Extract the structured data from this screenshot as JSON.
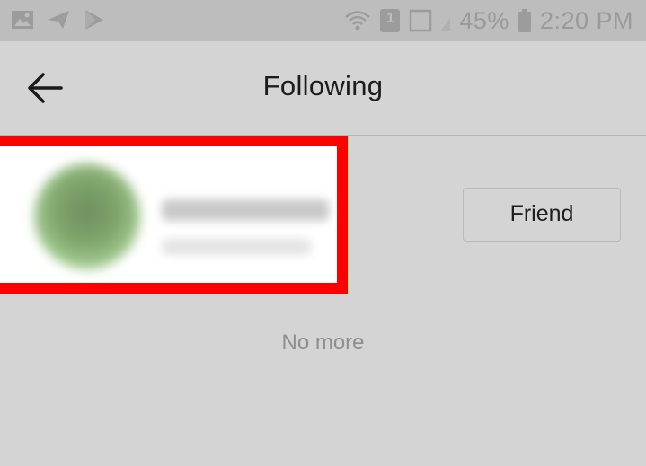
{
  "status_bar": {
    "battery_percent": "45%",
    "time": "2:20 PM",
    "sim_badge": "1",
    "left_icons": [
      "image-icon",
      "send-icon",
      "play-store-icon"
    ],
    "right_icons": [
      "wifi-icon",
      "sim-icon",
      "no-signal-icon",
      "battery-icon"
    ]
  },
  "app_bar": {
    "title": "Following",
    "back_icon": "arrow-left-icon"
  },
  "following_list": {
    "items": [
      {
        "avatar": "avatar-blurred",
        "action_label": "Friend"
      }
    ],
    "end_text": "No more"
  },
  "colors": {
    "highlight": "#ff0000",
    "background": "#d4d4d4",
    "status_bar": "#bdbdbd"
  }
}
